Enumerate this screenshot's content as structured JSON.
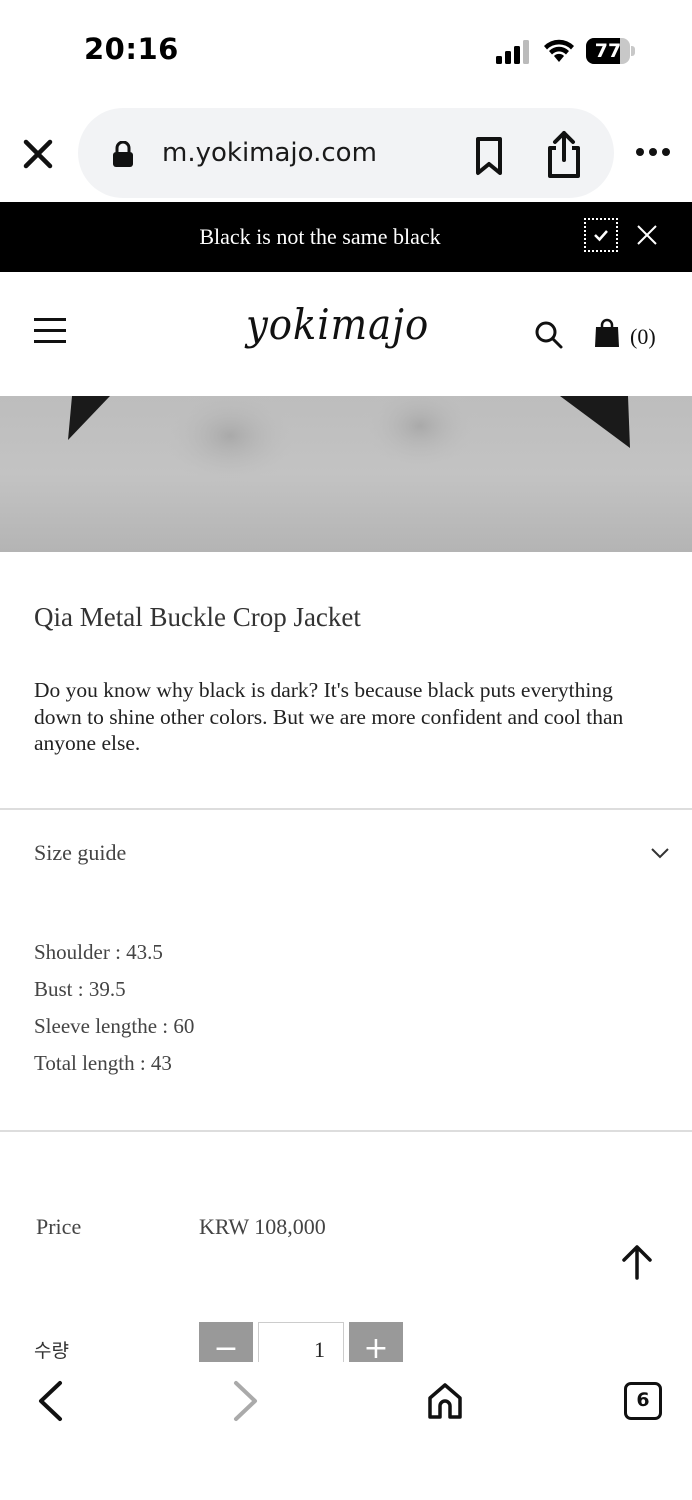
{
  "status_bar": {
    "time": "20:16",
    "battery_percent": "77",
    "battery_level": 0.77
  },
  "browser": {
    "url": "m.yokimajo.com",
    "open_tab_count": "6",
    "icons": [
      "close-icon",
      "lock-icon",
      "bookmark-icon",
      "share-icon",
      "more-icon",
      "back-icon",
      "forward-icon",
      "home-icon",
      "tabs-icon"
    ]
  },
  "announcement": {
    "text": "Black is not the same black"
  },
  "site_header": {
    "logo": "yokimajo",
    "cart_count": "(0)"
  },
  "product": {
    "title": "Qia Metal Buckle Crop Jacket",
    "description": "Do you know why black is dark? It's because black puts everything down to shine other colors. But we are more confident and cool than anyone else.",
    "size_guide_label": "Size guide",
    "sizes": [
      "Shoulder : 43.5",
      "Bust : 39.5",
      "Sleeve lengthe : 60",
      "Total length : 43"
    ],
    "price_label": "Price",
    "price_value": "KRW 108,000",
    "quantity_label": "수량",
    "quantity_value": "1",
    "minus_label": "−",
    "plus_label": "+"
  },
  "colors": {
    "announce_bg": "#000000",
    "qty_button_bg": "#999999"
  }
}
